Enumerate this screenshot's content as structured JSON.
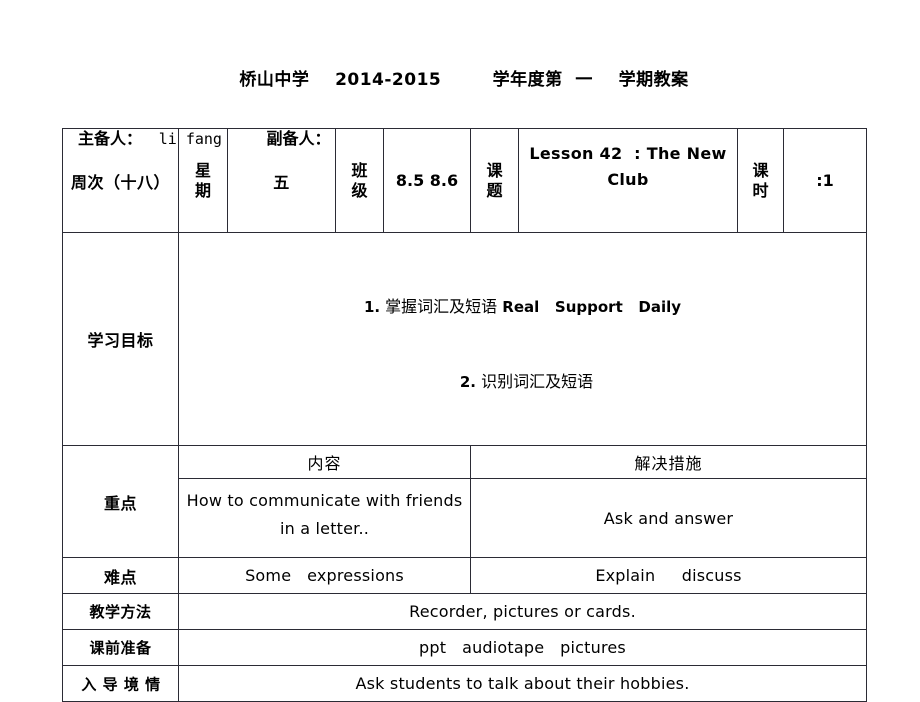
{
  "header": {
    "title": "桥山中学    2014-2015        学年度第  一    学期教案",
    "prepared_by_label": "主备人：",
    "prepared_by_value": "li fang",
    "assistant_label": "副备人：",
    "assistant_value": ""
  },
  "table": {
    "row_info": {
      "week_label": "周次（十八）",
      "weekday_label": "星\n期",
      "weekday_value": "五",
      "class_label": "班\n级",
      "class_value": "8.5 8.6",
      "topic_label": "课\n题",
      "topic_value": "Lesson 42  : The New Club",
      "periods_label": "课\n时",
      "periods_value": ":1"
    },
    "row_objectives": {
      "label": "学习目标",
      "line1_index": "1.",
      "line1_cn": " 掌握词汇及短语 ",
      "line1_en": "Real   Support   Daily",
      "line2_index": "2.",
      "line2_cn": " 识别词汇及短语"
    },
    "row_key_points": {
      "label": "重点",
      "col_head_content": "内容",
      "col_head_measure": "解决措施",
      "content": "How to communicate with friends in a letter..",
      "measure": "Ask and answer"
    },
    "row_difficulties": {
      "label": "难点",
      "content": "Some   expressions",
      "measure": "Explain     discuss"
    },
    "row_method": {
      "label": "教学方法",
      "value": "Recorder, pictures or cards."
    },
    "row_preparation": {
      "label": "课前准备",
      "value": "ppt   audiotape   pictures"
    },
    "row_lead_in": {
      "label": "入 导 境 情",
      "value": "Ask students to talk about their hobbies."
    }
  },
  "colors": {
    "border": "#2b2b35",
    "text": "#000000",
    "background": "#ffffff"
  }
}
